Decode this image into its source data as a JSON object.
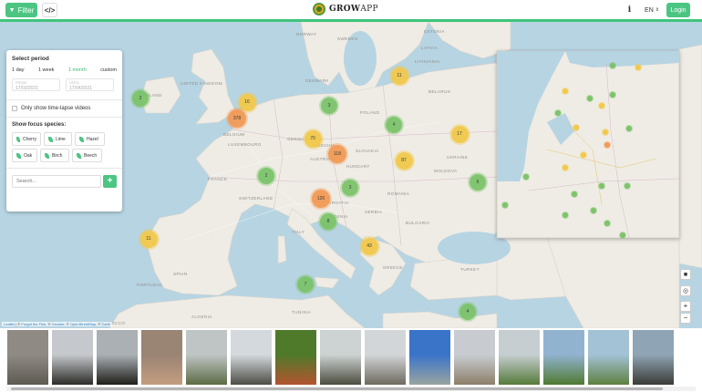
{
  "header": {
    "filter_label": "Filter",
    "code_icon": "code-icon",
    "logo_text_bold": "GROW",
    "logo_text_rest": "APP",
    "info_icon": "info-icon",
    "language": "EN",
    "login_label": "Login",
    "accent": "#3fc47b"
  },
  "panel": {
    "select_period_title": "Select period",
    "periods": [
      "1 day",
      "1 week",
      "1 month",
      "custom"
    ],
    "active_period": "1 month",
    "from_label": "FROM",
    "from_value": "17/03/2021",
    "until_label": "UNTIL",
    "until_value": "17/04/2021",
    "timelapse_label": "Only show time-lapse videos",
    "species_title": "Show focus species:",
    "species": [
      "Cherry",
      "Lime",
      "Hazel",
      "Oak",
      "Birch",
      "Beech"
    ],
    "search_placeholder": "Search...",
    "add_label": "+"
  },
  "map": {
    "clusters": [
      {
        "n": "2",
        "c": "green"
      },
      {
        "n": "11",
        "c": "yellow"
      },
      {
        "n": "16",
        "c": "yellow"
      },
      {
        "n": "3",
        "c": "green"
      },
      {
        "n": "378",
        "c": "orange"
      },
      {
        "n": "4",
        "c": "green"
      },
      {
        "n": "17",
        "c": "yellow"
      },
      {
        "n": "70",
        "c": "yellow"
      },
      {
        "n": "118",
        "c": "orange"
      },
      {
        "n": "87",
        "c": "yellow"
      },
      {
        "n": "2",
        "c": "green"
      },
      {
        "n": "6",
        "c": "green"
      },
      {
        "n": "3",
        "c": "green"
      },
      {
        "n": "126",
        "c": "orange"
      },
      {
        "n": "8",
        "c": "green"
      },
      {
        "n": "11",
        "c": "yellow"
      },
      {
        "n": "43",
        "c": "yellow"
      },
      {
        "n": "7",
        "c": "green"
      },
      {
        "n": "4",
        "c": "green"
      }
    ],
    "country_labels": [
      "UNITED KINGDOM",
      "IRELAND",
      "FRANCE",
      "SPAIN",
      "PORTUGAL",
      "GERMANY",
      "POLAND",
      "ITALY",
      "BELARUS",
      "UKRAINE",
      "ROMANIA",
      "TURKEY",
      "ALGERIA",
      "TUNISIA",
      "SWEDEN",
      "NORWAY",
      "DENMARK",
      "CZECHIA",
      "AUSTRIA",
      "HUNGARY",
      "SERBIA",
      "BULGARIA",
      "GREECE",
      "LUXEMBOURG",
      "BELGIUM",
      "SLOVAKIA",
      "MOLDOVA",
      "SWITZERLAND",
      "BOSNIA",
      "LATVIA",
      "LITHUANIA",
      "ESTONIA",
      "MOROCCO",
      "CROATIA"
    ],
    "attribution": [
      "Leaflet",
      " | © ",
      "Forget the Fish",
      ", © ",
      "Geoster",
      ", © ",
      "OpenStreetMap",
      ", © ",
      "Carto"
    ],
    "colors": {
      "water": "#b7d4e2",
      "land": "#eeebe4",
      "green": "#7cc36a",
      "yellow": "#f2c94c",
      "orange": "#f29a56"
    }
  },
  "controls": {
    "camera_icon": "camera-icon",
    "locate_icon": "locate-icon",
    "zoom_in": "+",
    "zoom_out": "−"
  },
  "thumbnails": [
    {
      "alt": "hand holding twig",
      "colors": [
        "#8f8a84",
        "#5d5a52"
      ]
    },
    {
      "alt": "bare tree against sky",
      "colors": [
        "#c5c8cc",
        "#2c2c28"
      ]
    },
    {
      "alt": "dark tree branches",
      "colors": [
        "#aab0b4",
        "#1f1e1a"
      ]
    },
    {
      "alt": "close up red buds",
      "colors": [
        "#9a8474",
        "#c49d7f"
      ]
    },
    {
      "alt": "tree in field",
      "colors": [
        "#bfc4c5",
        "#5c6c45"
      ]
    },
    {
      "alt": "bare tree park",
      "colors": [
        "#d4d9dd",
        "#4d4d45"
      ]
    },
    {
      "alt": "red flowers close up",
      "colors": [
        "#4f7a2a",
        "#b3542f"
      ]
    },
    {
      "alt": "trees along road",
      "colors": [
        "#cdd2d2",
        "#4c4d3f"
      ]
    },
    {
      "alt": "bare tree lawn",
      "colors": [
        "#d3d6d8",
        "#6d6a5e"
      ]
    },
    {
      "alt": "blue sky young tree",
      "colors": [
        "#3a74c9",
        "#9aa4a0"
      ]
    },
    {
      "alt": "tree near building",
      "colors": [
        "#c8ccd0",
        "#8d7f6a"
      ]
    },
    {
      "alt": "bare tree grass",
      "colors": [
        "#c6ced2",
        "#567a3a"
      ]
    },
    {
      "alt": "green park tree",
      "colors": [
        "#91b3d0",
        "#4f7a32"
      ]
    },
    {
      "alt": "budding tree sky",
      "colors": [
        "#a3c2d6",
        "#5e8040"
      ]
    },
    {
      "alt": "trees dusk",
      "colors": [
        "#8fa4b4",
        "#3a3b36"
      ]
    }
  ]
}
